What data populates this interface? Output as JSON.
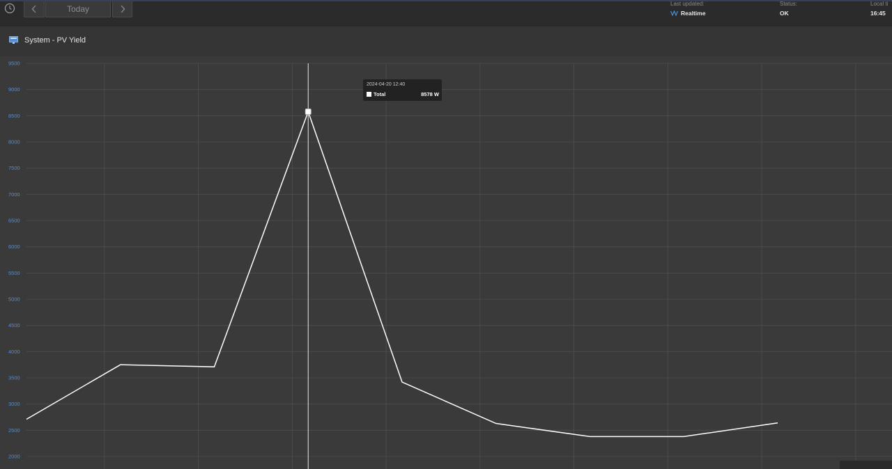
{
  "nav": {
    "prev": "‹",
    "today": "Today",
    "next": "›"
  },
  "status_bar": {
    "last_updated_label": "Last updated:",
    "last_updated_value": "Realtime",
    "status_label": "Status:",
    "status_value": "OK",
    "local_time_label": "Local ti",
    "local_time_value": "16:45"
  },
  "panel": {
    "title": "System - PV Yield"
  },
  "tooltip": {
    "date": "2024-04-20 12:40",
    "series": "Total",
    "value": "8578 W"
  },
  "colors": {
    "line": "#ffffff",
    "ytick": "#4f8fd6",
    "grid": "#4e4e4e",
    "background": "#3a3a3a"
  },
  "chart_data": {
    "type": "line",
    "ylim": [
      2000,
      9500
    ],
    "yticks": [
      2000,
      2500,
      3000,
      3500,
      4000,
      4500,
      5000,
      5500,
      6000,
      6500,
      7000,
      7500,
      8000,
      8500,
      9000,
      9500
    ],
    "grid": true,
    "series": [
      {
        "name": "Total",
        "values": [
          2710,
          3750,
          3710,
          8578,
          3420,
          2630,
          2380,
          2380,
          2640
        ]
      }
    ],
    "highlight_index": 3
  }
}
